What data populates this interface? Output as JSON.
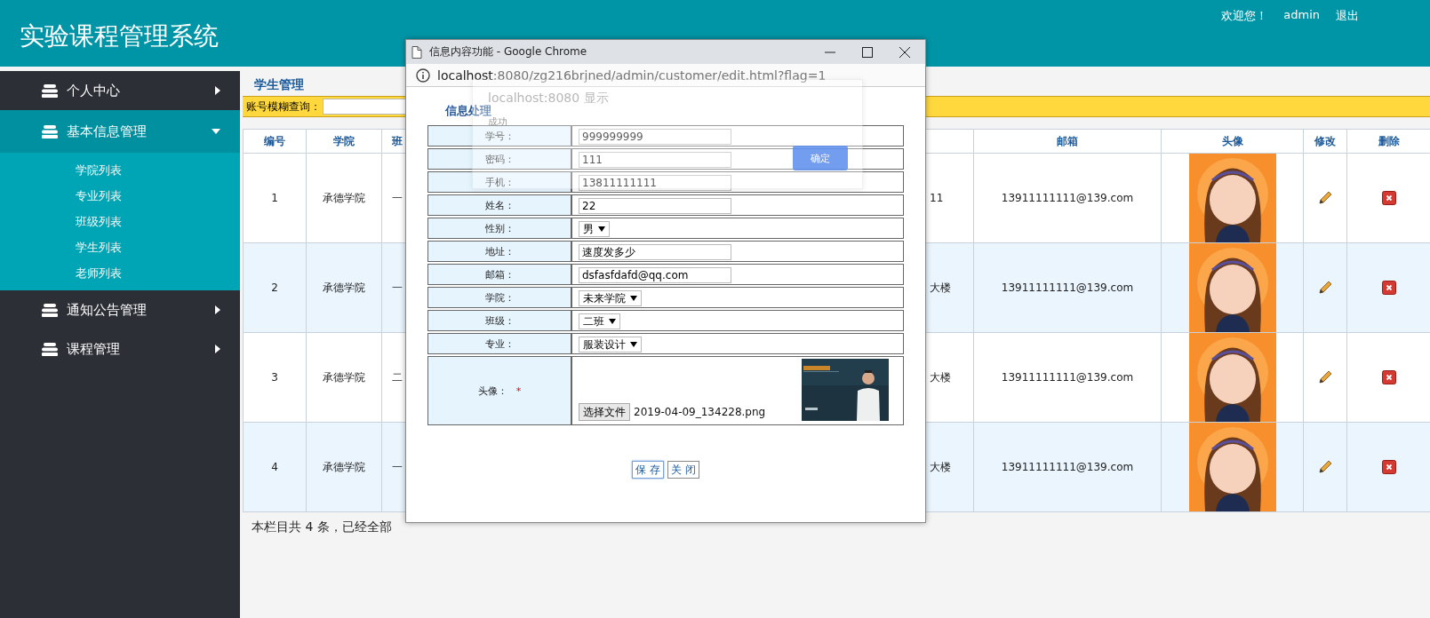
{
  "header": {
    "title": "实验课程管理系统",
    "welcome": "欢迎您！",
    "user": "admin",
    "logout": "退出"
  },
  "sidebar": {
    "items": [
      {
        "label": "个人中心",
        "expanded": false
      },
      {
        "label": "基本信息管理",
        "expanded": true,
        "children": [
          {
            "label": "学院列表"
          },
          {
            "label": "专业列表"
          },
          {
            "label": "班级列表"
          },
          {
            "label": "学生列表"
          },
          {
            "label": "老师列表"
          }
        ]
      },
      {
        "label": "通知公告管理",
        "expanded": false
      },
      {
        "label": "课程管理",
        "expanded": false
      }
    ]
  },
  "main": {
    "heading": "学生管理",
    "search": {
      "label": "账号模糊查询："
    },
    "table": {
      "columns": {
        "number": "编号",
        "college": "学院",
        "column_3": "班",
        "email": "邮箱",
        "avatar": "头像",
        "edit": "修改",
        "delete": "删除"
      },
      "rows": [
        {
          "number": "1",
          "college": "承德学院",
          "column_3": "一",
          "column_4": "11",
          "email": "13911111111@139.com"
        },
        {
          "number": "2",
          "college": "承德学院",
          "column_3": "一",
          "column_4": "大楼",
          "email": "13911111111@139.com"
        },
        {
          "number": "3",
          "college": "承德学院",
          "column_3": "二",
          "column_4": "大楼",
          "email": "13911111111@139.com"
        },
        {
          "number": "4",
          "college": "承德学院",
          "column_3": "一",
          "column_4": "大楼",
          "email": "13911111111@139.com"
        }
      ]
    },
    "footer": "本栏目共 4 条，已经全部"
  },
  "popup": {
    "title": "信息内容功能 - Google Chrome",
    "url_host": "localhost",
    "url_rest": ":8080/zg216brjned/admin/customer/edit.html?flag=1",
    "alert": {
      "origin": "localhost:8080 显示",
      "message": "成功",
      "button": "确定"
    },
    "form": {
      "title": "信息处理",
      "fields": [
        {
          "label": "学号：",
          "kind": "input",
          "value": "999999999"
        },
        {
          "label": "密码：",
          "kind": "input",
          "value": "111"
        },
        {
          "label": "手机：",
          "kind": "input",
          "value": "13811111111"
        },
        {
          "label": "姓名：",
          "kind": "input",
          "value": "22"
        },
        {
          "label": "性别：",
          "kind": "select",
          "value": "男"
        },
        {
          "label": "地址：",
          "kind": "input",
          "value": "速度发多少"
        },
        {
          "label": "邮箱：",
          "kind": "input",
          "value": "dsfasfdafd@qq.com"
        },
        {
          "label": "学院：",
          "kind": "select",
          "value": "未来学院"
        },
        {
          "label": "班级：",
          "kind": "select",
          "value": "二班"
        },
        {
          "label": "专业：",
          "kind": "select",
          "value": "服装设计"
        },
        {
          "label": "头像：",
          "kind": "file",
          "required_mark": "*",
          "button": "选择文件",
          "value": "2019-04-09_134228.png"
        }
      ],
      "buttons": [
        "保 存",
        "关 闭"
      ]
    }
  }
}
